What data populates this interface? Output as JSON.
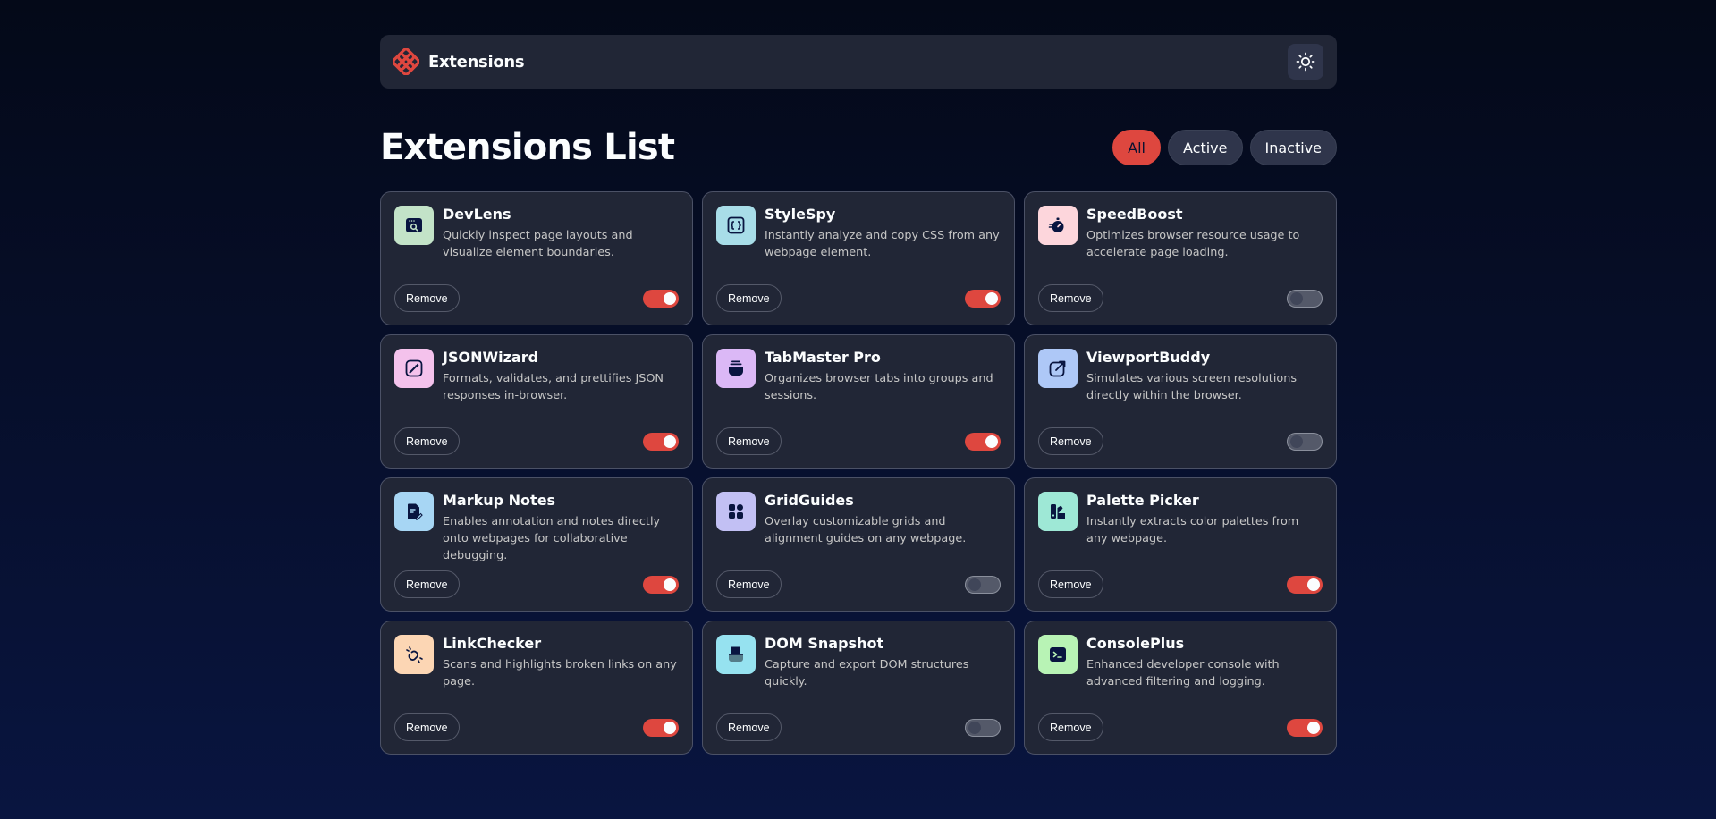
{
  "header": {
    "brand_name": "Extensions",
    "logo_icon": "logo-icon",
    "theme_icon": "sun-icon"
  },
  "list": {
    "title": "Extensions List",
    "filters": [
      {
        "label": "All",
        "active": true
      },
      {
        "label": "Active",
        "active": false
      },
      {
        "label": "Inactive",
        "active": false
      }
    ]
  },
  "colors": {
    "accent": "#de473f",
    "card_bg": "#212636",
    "page_bg_top": "#040918",
    "page_bg_bottom": "#091540"
  },
  "remove_label": "Remove",
  "extensions": [
    {
      "name": "DevLens",
      "description": "Quickly inspect page layouts and visualize element boundaries.",
      "enabled": true,
      "icon": "browser-search-icon",
      "icon_bg": "#c3e3c8"
    },
    {
      "name": "StyleSpy",
      "description": "Instantly analyze and copy CSS from any webpage element.",
      "enabled": true,
      "icon": "braces-icon",
      "icon_bg": "#a8dde8"
    },
    {
      "name": "SpeedBoost",
      "description": "Optimizes browser resource usage to accelerate page loading.",
      "enabled": false,
      "icon": "stopwatch-icon",
      "icon_bg": "#fdd6dc"
    },
    {
      "name": "JSONWizard",
      "description": "Formats, validates, and prettifies JSON responses in-browser.",
      "enabled": true,
      "icon": "wand-icon",
      "icon_bg": "#f4c2ec"
    },
    {
      "name": "TabMaster Pro",
      "description": "Organizes browser tabs into groups and sessions.",
      "enabled": true,
      "icon": "tab-stack-icon",
      "icon_bg": "#dbb8f6"
    },
    {
      "name": "ViewportBuddy",
      "description": "Simulates various screen resolutions directly within the browser.",
      "enabled": false,
      "icon": "external-link-icon",
      "icon_bg": "#aec8f7"
    },
    {
      "name": "Markup Notes",
      "description": "Enables annotation and notes directly onto webpages for collaborative debugging.",
      "enabled": true,
      "icon": "note-pencil-icon",
      "icon_bg": "#a7d6f4"
    },
    {
      "name": "GridGuides",
      "description": "Overlay customizable grids and alignment guides on any webpage.",
      "enabled": false,
      "icon": "grid-icon",
      "icon_bg": "#c2c0f4"
    },
    {
      "name": "Palette Picker",
      "description": "Instantly extracts color palettes from any webpage.",
      "enabled": true,
      "icon": "palette-icon",
      "icon_bg": "#9ee8d6"
    },
    {
      "name": "LinkChecker",
      "description": "Scans and highlights broken links on any page.",
      "enabled": true,
      "icon": "broken-link-icon",
      "icon_bg": "#fcd6b4"
    },
    {
      "name": "DOM Snapshot",
      "description": "Capture and export DOM structures quickly.",
      "enabled": false,
      "icon": "snapshot-icon",
      "icon_bg": "#96e2f0"
    },
    {
      "name": "ConsolePlus",
      "description": "Enhanced developer console with advanced filtering and logging.",
      "enabled": true,
      "icon": "terminal-icon",
      "icon_bg": "#b8f3b5"
    }
  ]
}
